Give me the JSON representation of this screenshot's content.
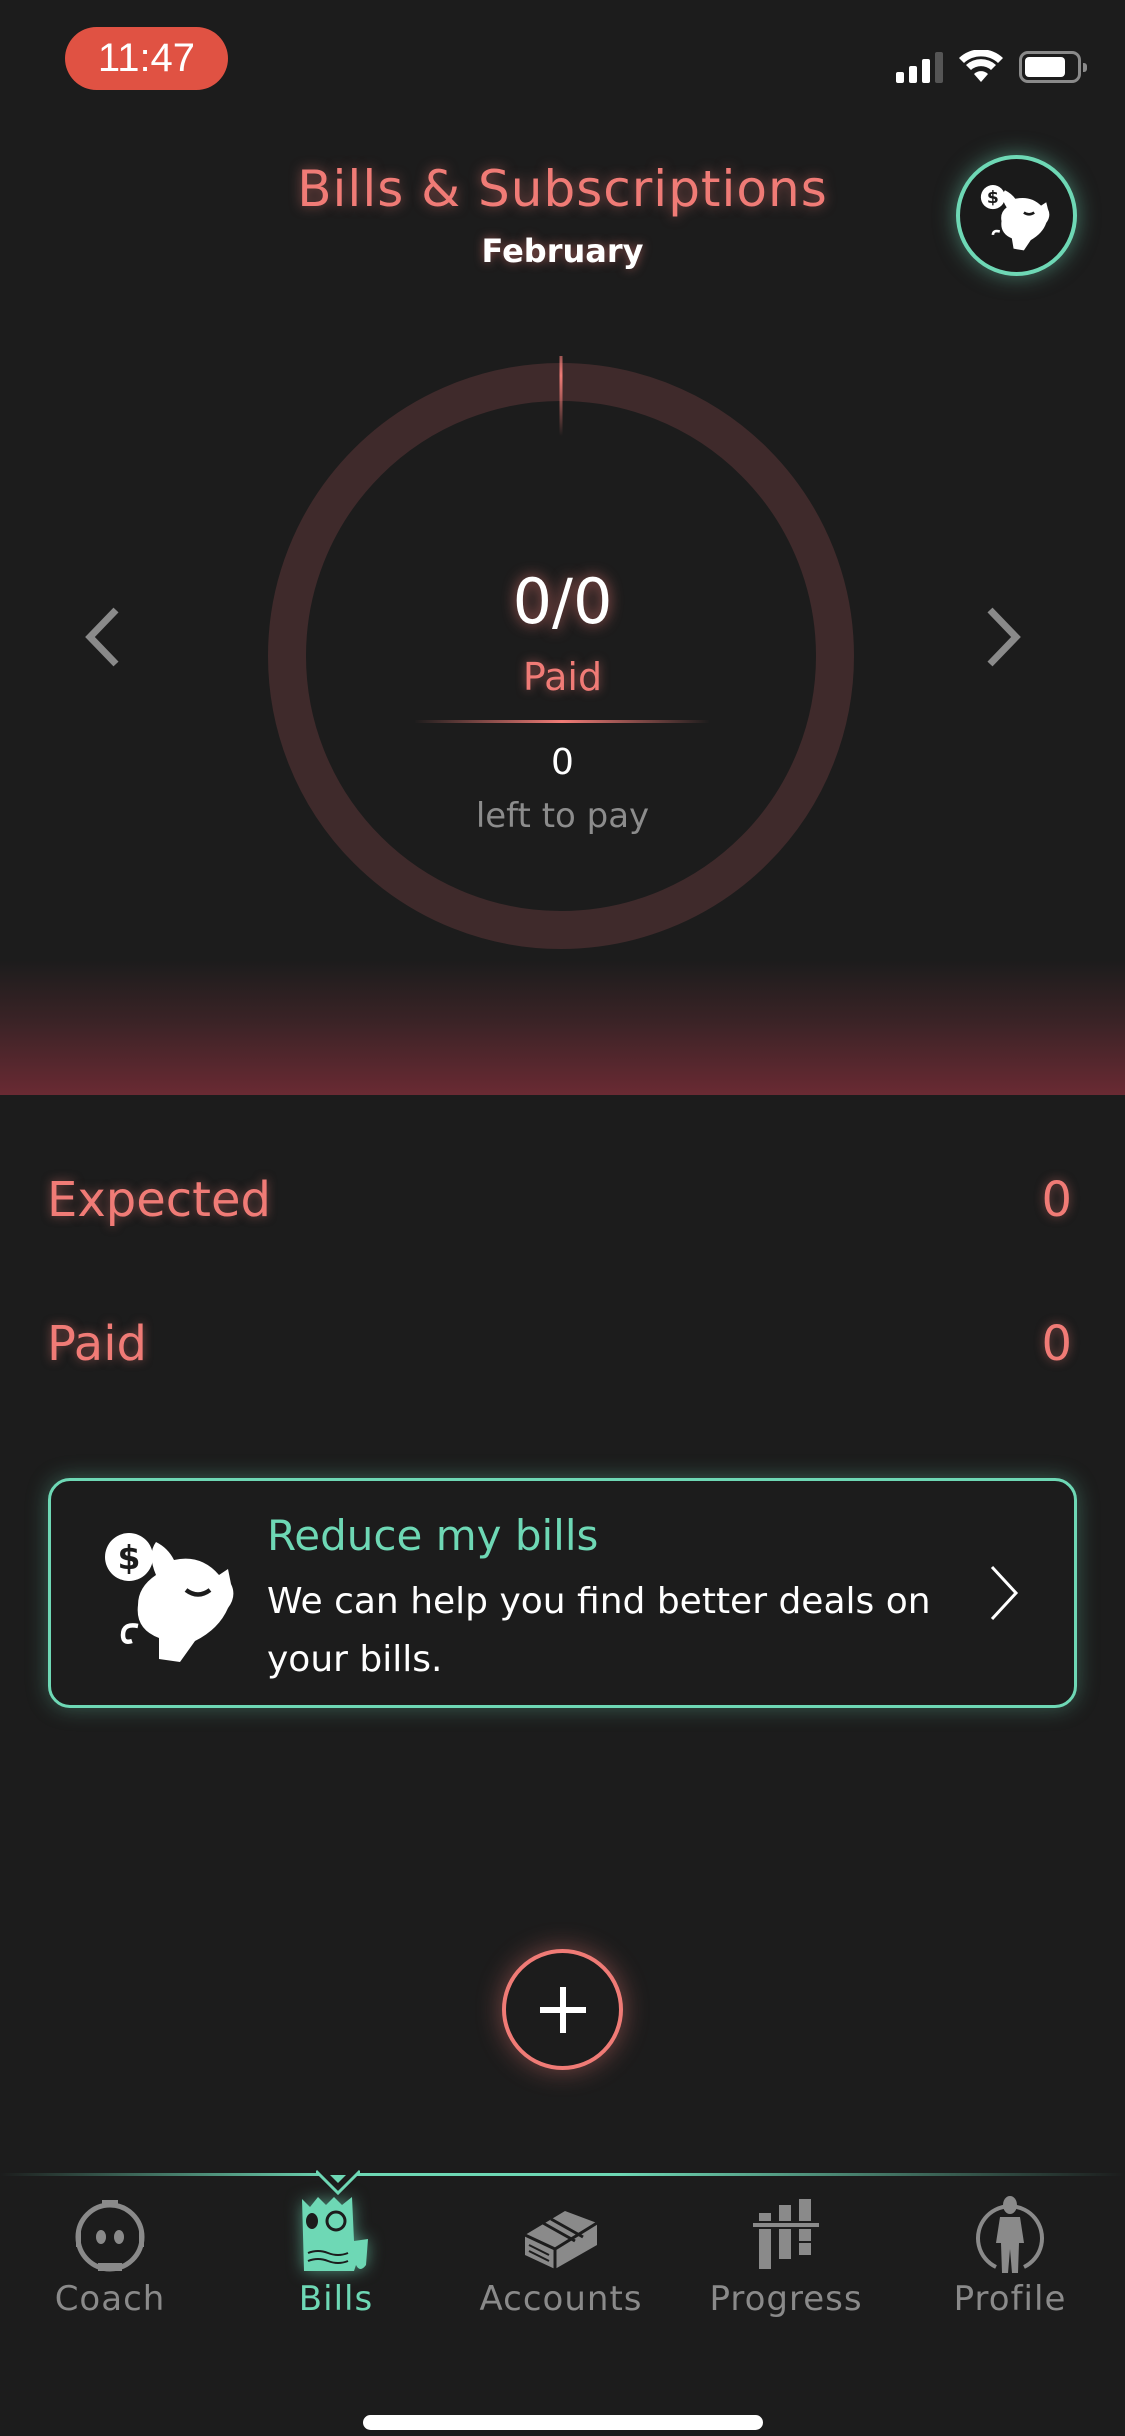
{
  "status_bar": {
    "time": "11:47",
    "signal_bars_filled": 3,
    "signal_bars_total": 4,
    "battery_level": 0.8
  },
  "header": {
    "title": "Bills & Subscriptions",
    "month": "February",
    "avatar_icon": "piggy-bank-icon"
  },
  "summary_ring": {
    "count": "0/0",
    "count_label": "Paid",
    "paid_fraction": 0,
    "left_value": "0",
    "left_label": "left to pay",
    "prev_icon": "chevron-left-icon",
    "next_icon": "chevron-right-icon"
  },
  "rows": [
    {
      "label": "Expected",
      "value": "0"
    },
    {
      "label": "Paid",
      "value": "0"
    }
  ],
  "promo_card": {
    "title": "Reduce my bills",
    "description": "We can help you find better deals on your bills.",
    "icon": "piggy-bank-icon"
  },
  "add_button": {
    "icon": "plus-icon"
  },
  "tabs": [
    {
      "label": "Coach",
      "icon": "robot-head-icon",
      "active": false
    },
    {
      "label": "Bills",
      "icon": "receipt-icon",
      "active": true
    },
    {
      "label": "Accounts",
      "icon": "money-stack-icon",
      "active": false
    },
    {
      "label": "Progress",
      "icon": "bar-chart-icon",
      "active": false
    },
    {
      "label": "Profile",
      "icon": "person-icon",
      "active": false
    }
  ],
  "colors": {
    "accent_red": "#f07b76",
    "accent_green": "#6ed8b5",
    "background": "#1c1c1c",
    "ring_track": "#3f2a2b",
    "time_pill": "#e05243",
    "inactive": "#8a8a8a"
  }
}
